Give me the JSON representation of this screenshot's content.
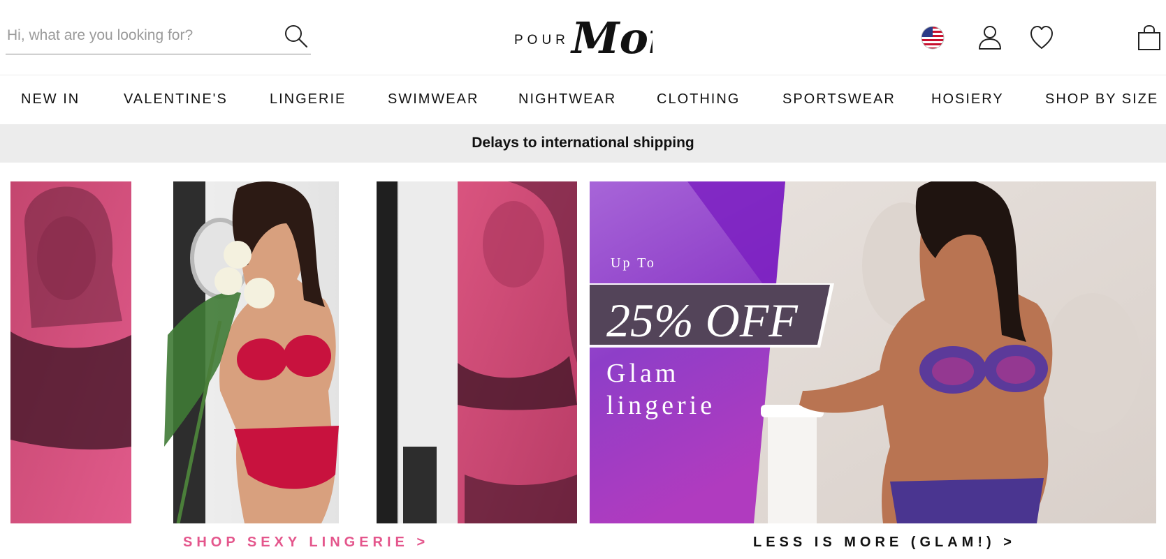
{
  "search": {
    "placeholder": "Hi, what are you looking for?"
  },
  "brand": {
    "logo_small": "POUR",
    "logo_script": "Moi"
  },
  "header_icons": [
    "us-flag-icon",
    "account-icon",
    "wishlist-heart-icon",
    "shopping-bag-icon"
  ],
  "nav": {
    "items": [
      "NEW IN",
      "VALENTINE'S",
      "LINGERIE",
      "SWIMWEAR",
      "NIGHTWEAR",
      "CLOTHING",
      "SPORTSWEAR",
      "HOSIERY",
      "SHOP BY SIZE"
    ]
  },
  "notice": {
    "text": "Delays to international shipping"
  },
  "banners": {
    "left": {
      "cta": "SHOP SEXY LINGERIE >"
    },
    "right": {
      "up_to": "Up To",
      "percent": "25% OFF",
      "title": "Glam lingerie",
      "cta": "LESS IS MORE (GLAM!) >"
    }
  },
  "colors": {
    "accent_pink": "#e4568c",
    "promo_purple": "#8a2fc9",
    "notice_bg": "#ececec"
  }
}
